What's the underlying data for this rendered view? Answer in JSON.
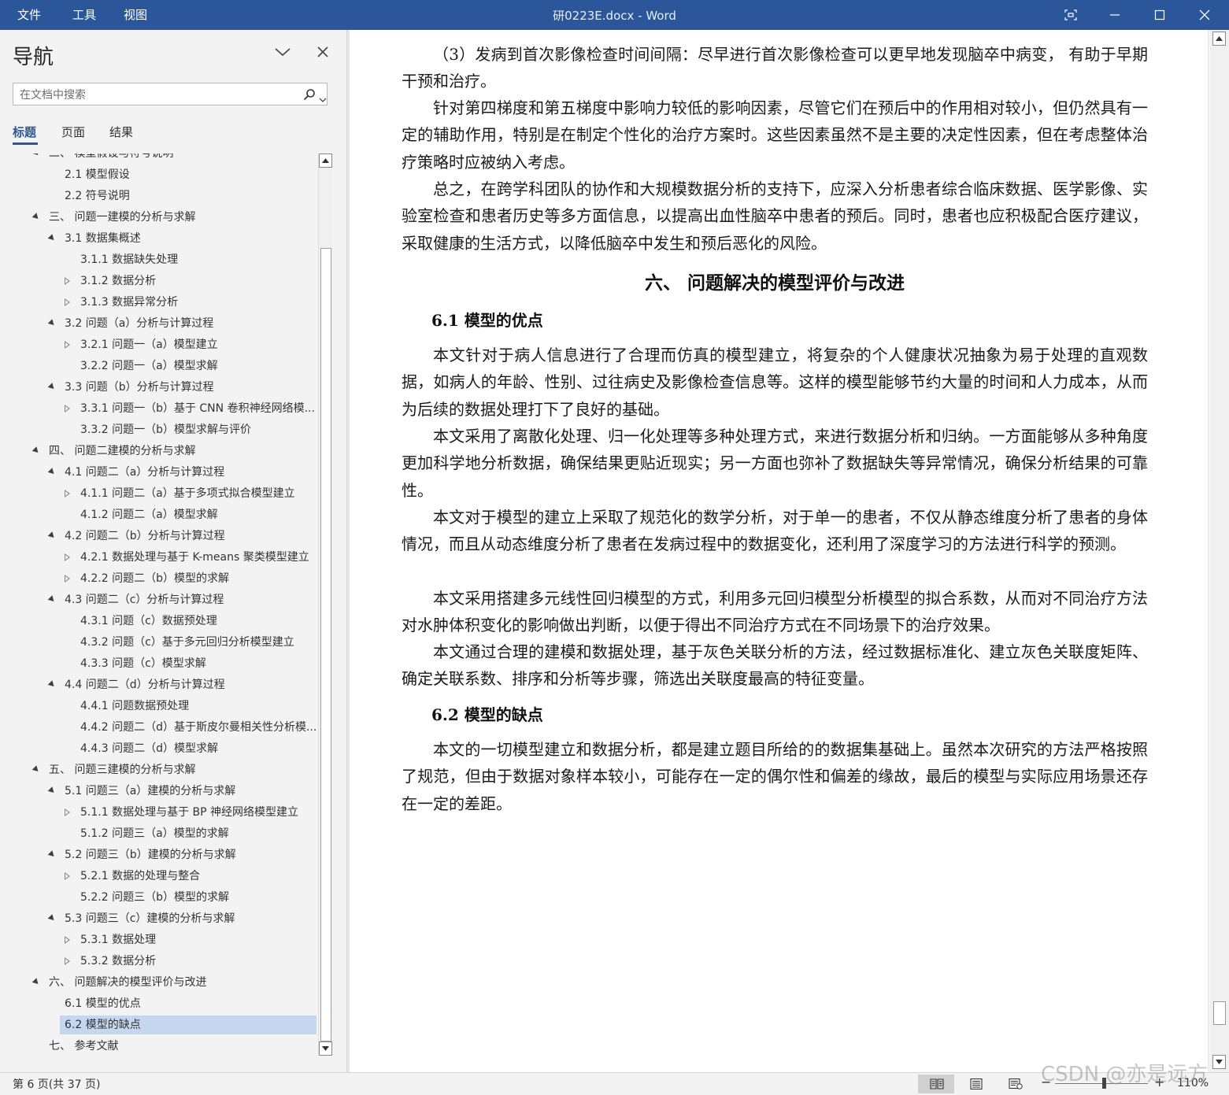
{
  "titlebar": {
    "menus": [
      "文件",
      "工具",
      "视图"
    ],
    "title": "研0223E.docx  -  Word",
    "buttons": [
      "focus-mode",
      "minimize",
      "maximize",
      "close"
    ]
  },
  "nav": {
    "title": "导航",
    "search_placeholder": "在文档中搜索",
    "tabs": [
      "标题",
      "页面",
      "结果"
    ],
    "active_tab": "标题",
    "items": [
      {
        "label": "二、 模型假设与符号说明",
        "level": 1,
        "toggle": "expanded"
      },
      {
        "label": "2.1 模型假设",
        "level": 2,
        "toggle": "none"
      },
      {
        "label": "2.2 符号说明",
        "level": 2,
        "toggle": "none"
      },
      {
        "label": "三、 问题一建模的分析与求解",
        "level": 1,
        "toggle": "expanded"
      },
      {
        "label": "3.1 数据集概述",
        "level": 2,
        "toggle": "expanded"
      },
      {
        "label": "3.1.1 数据缺失处理",
        "level": 3,
        "toggle": "none"
      },
      {
        "label": "3.1.2 数据分析",
        "level": 3,
        "toggle": "collapsed"
      },
      {
        "label": "3.1.3 数据异常分析",
        "level": 3,
        "toggle": "collapsed"
      },
      {
        "label": "3.2 问题（a）分析与计算过程",
        "level": 2,
        "toggle": "expanded"
      },
      {
        "label": "3.2.1 问题一（a）模型建立",
        "level": 3,
        "toggle": "collapsed"
      },
      {
        "label": "3.2.2 问题一（a）模型求解",
        "level": 3,
        "toggle": "none"
      },
      {
        "label": "3.3 问题（b）分析与计算过程",
        "level": 2,
        "toggle": "expanded"
      },
      {
        "label": "3.3.1 问题一（b）基于 CNN 卷积神经网络模...",
        "level": 3,
        "toggle": "collapsed"
      },
      {
        "label": "3.3.2 问题一（b）模型求解与评价",
        "level": 3,
        "toggle": "none"
      },
      {
        "label": "四、 问题二建模的分析与求解",
        "level": 1,
        "toggle": "expanded"
      },
      {
        "label": "4.1 问题二（a）分析与计算过程",
        "level": 2,
        "toggle": "expanded"
      },
      {
        "label": "4.1.1 问题二（a）基于多项式拟合模型建立",
        "level": 3,
        "toggle": "collapsed"
      },
      {
        "label": "4.1.2 问题二（a）模型求解",
        "level": 3,
        "toggle": "none"
      },
      {
        "label": "4.2 问题二（b）分析与计算过程",
        "level": 2,
        "toggle": "expanded"
      },
      {
        "label": "4.2.1 数据处理与基于 K-means 聚类模型建立",
        "level": 3,
        "toggle": "collapsed"
      },
      {
        "label": "4.2.2 问题二（b）模型的求解",
        "level": 3,
        "toggle": "collapsed"
      },
      {
        "label": "4.3 问题二（c）分析与计算过程",
        "level": 2,
        "toggle": "expanded"
      },
      {
        "label": "4.3.1 问题（c）数据预处理",
        "level": 3,
        "toggle": "none"
      },
      {
        "label": "4.3.2 问题（c）基于多元回归分析模型建立",
        "level": 3,
        "toggle": "none"
      },
      {
        "label": "4.3.3 问题（c）模型求解",
        "level": 3,
        "toggle": "none"
      },
      {
        "label": "4.4 问题二（d）分析与计算过程",
        "level": 2,
        "toggle": "expanded"
      },
      {
        "label": "4.4.1 问题数据预处理",
        "level": 3,
        "toggle": "none"
      },
      {
        "label": "4.4.2 问题二（d）基于斯皮尔曼相关性分析模...",
        "level": 3,
        "toggle": "none"
      },
      {
        "label": "4.4.3 问题二（d）模型求解",
        "level": 3,
        "toggle": "none"
      },
      {
        "label": "五、 问题三建模的分析与求解",
        "level": 1,
        "toggle": "expanded"
      },
      {
        "label": "5.1 问题三（a）建模的分析与求解",
        "level": 2,
        "toggle": "expanded"
      },
      {
        "label": "5.1.1 数据处理与基于 BP 神经网络模型建立",
        "level": 3,
        "toggle": "collapsed"
      },
      {
        "label": "5.1.2 问题三（a）模型的求解",
        "level": 3,
        "toggle": "none"
      },
      {
        "label": "5.2 问题三（b）建模的分析与求解",
        "level": 2,
        "toggle": "expanded"
      },
      {
        "label": "5.2.1 数据的处理与整合",
        "level": 3,
        "toggle": "collapsed"
      },
      {
        "label": "5.2.2 问题三（b）模型的求解",
        "level": 3,
        "toggle": "none"
      },
      {
        "label": "5.3 问题三（c）建模的分析与求解",
        "level": 2,
        "toggle": "expanded"
      },
      {
        "label": "5.3.1 数据处理",
        "level": 3,
        "toggle": "collapsed"
      },
      {
        "label": "5.3.2 数据分析",
        "level": 3,
        "toggle": "collapsed"
      },
      {
        "label": "六、 问题解决的模型评价与改进",
        "level": 1,
        "toggle": "expanded"
      },
      {
        "label": "6.1 模型的优点",
        "level": 2,
        "toggle": "none"
      },
      {
        "label": "6.2 模型的缺点",
        "level": 2,
        "toggle": "none",
        "selected": true
      },
      {
        "label": "七、 参考文献",
        "level": 1,
        "toggle": "none"
      }
    ]
  },
  "document": {
    "p1": "（3）发病到首次影像检查时间间隔：尽早进行首次影像检查可以更早地发现脑卒中病变， 有助于早期干预和治疗。",
    "p2": "针对第四梯度和第五梯度中影响力较低的影响因素，尽管它们在预后中的作用相对较小，但仍然具有一定的辅助作用，特别是在制定个性化的治疗方案时。这些因素虽然不是主要的决定性因素，但在考虑整体治疗策略时应被纳入考虑。",
    "p3": "总之，在跨学科团队的协作和大规模数据分析的支持下，应深入分析患者综合临床数据、医学影像、实验室检查和患者历史等多方面信息，以提高出血性脑卒中患者的预后。同时，患者也应积极配合医疗建议，采取健康的生活方式，以降低脑卒中发生和预后恶化的风险。",
    "h1": "六、 问题解决的模型评价与改进",
    "h2a": "6.1 模型的优点",
    "p4": "本文针对于病人信息进行了合理而仿真的模型建立，将复杂的个人健康状况抽象为易于处理的直观数据，如病人的年龄、性别、过往病史及影像检查信息等。这样的模型能够节约大量的时间和人力成本，从而为后续的数据处理打下了良好的基础。",
    "p5": "本文采用了离散化处理、归一化处理等多种处理方式，来进行数据分析和归纳。一方面能够从多种角度更加科学地分析数据，确保结果更贴近现实；另一方面也弥补了数据缺失等异常情况，确保分析结果的可靠性。",
    "p6": "本文对于模型的建立上采取了规范化的数学分析，对于单一的患者，不仅从静态维度分析了患者的身体情况，而且从动态维度分析了患者在发病过程中的数据变化，还利用了深度学习的方法进行科学的预测。",
    "p7": "本文采用搭建多元线性回归模型的方式，利用多元回归模型分析模型的拟合系数，从而对不同治疗方法对水肿体积变化的影响做出判断，以便于得出不同治疗方式在不同场景下的治疗效果。",
    "p8": "本文通过合理的建模和数据处理，基于灰色关联分析的方法，经过数据标准化、建立灰色关联度矩阵、确定关联系数、排序和分析等步骤，筛选出关联度最高的特征变量。",
    "h2b": "6.2 模型的缺点",
    "p9": "本文的一切模型建立和数据分析，都是建立题目所给的的数据集基础上。虽然本次研究的方法严格按照了规范，但由于数据对象样本较小，可能存在一定的偶尔性和偏差的缘故，最后的模型与实际应用场景还存在一定的差距。"
  },
  "statusbar": {
    "page_count": "第 6 页(共 37 页)",
    "zoom_minus": "−",
    "zoom_plus": "+",
    "zoom_level": "110%"
  },
  "watermark": "CSDN @亦是远方",
  "colors": {
    "titlebar": "#2b579a",
    "selected_item": "#c5d6ef",
    "accent": "#2b579a"
  }
}
